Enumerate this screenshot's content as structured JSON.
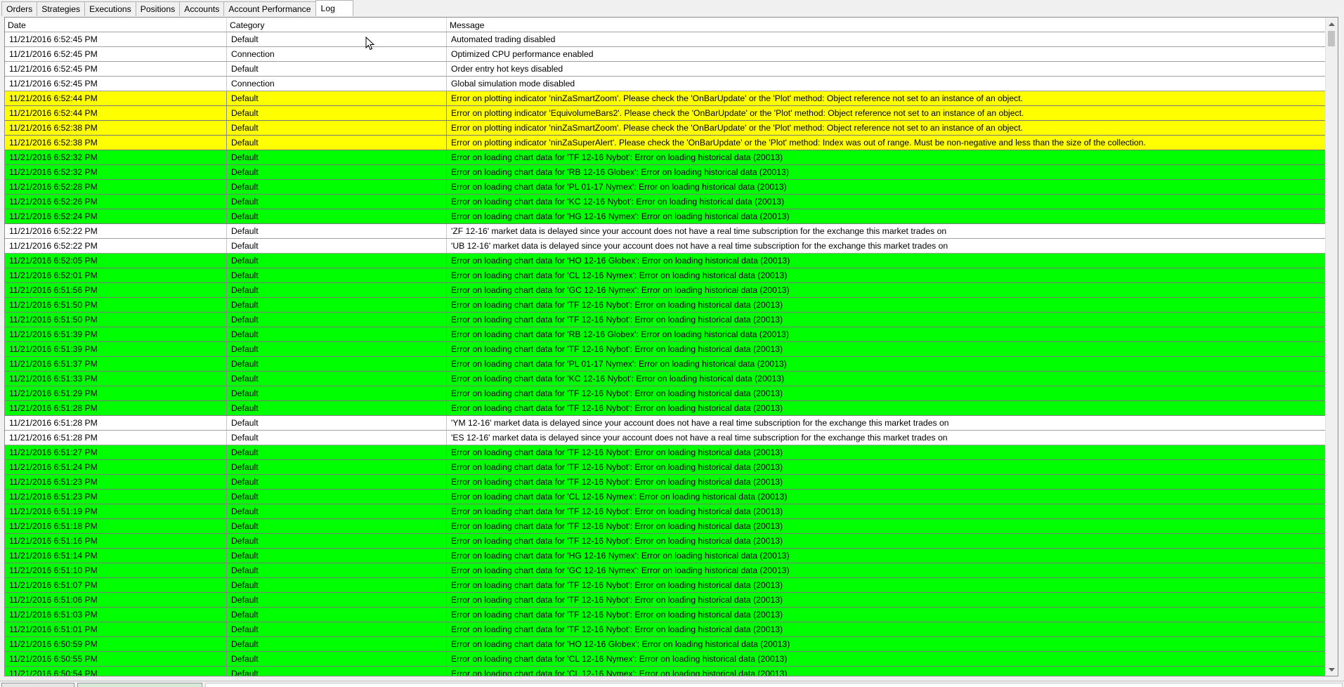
{
  "tabs": [
    {
      "label": "Orders",
      "active": false
    },
    {
      "label": "Strategies",
      "active": false
    },
    {
      "label": "Executions",
      "active": false
    },
    {
      "label": "Positions",
      "active": false
    },
    {
      "label": "Accounts",
      "active": false
    },
    {
      "label": "Account Performance",
      "active": false
    },
    {
      "label": "Log",
      "active": true
    }
  ],
  "grid": {
    "columns": {
      "date": "Date",
      "category": "Category",
      "message": "Message"
    },
    "row_colors": {
      "white": "#ffffff",
      "yellow": "#ffff00",
      "green": "#00ff00"
    },
    "rows": [
      {
        "date": "11/21/2016 6:52:45 PM",
        "category": "Default",
        "message": "Automated trading disabled",
        "color": "white"
      },
      {
        "date": "11/21/2016 6:52:45 PM",
        "category": "Connection",
        "message": "Optimized CPU performance enabled",
        "color": "white"
      },
      {
        "date": "11/21/2016 6:52:45 PM",
        "category": "Default",
        "message": "Order entry hot keys disabled",
        "color": "white"
      },
      {
        "date": "11/21/2016 6:52:45 PM",
        "category": "Connection",
        "message": "Global simulation mode disabled",
        "color": "white"
      },
      {
        "date": "11/21/2016 6:52:44 PM",
        "category": "Default",
        "message": "Error on plotting indicator 'ninZaSmartZoom'. Please check the 'OnBarUpdate' or the 'Plot' method: Object reference not set to an instance of an object.",
        "color": "yellow"
      },
      {
        "date": "11/21/2016 6:52:44 PM",
        "category": "Default",
        "message": "Error on plotting indicator 'EquivolumeBars2'. Please check the 'OnBarUpdate' or the 'Plot' method: Object reference not set to an instance of an object.",
        "color": "yellow"
      },
      {
        "date": "11/21/2016 6:52:38 PM",
        "category": "Default",
        "message": "Error on plotting indicator 'ninZaSmartZoom'. Please check the 'OnBarUpdate' or the 'Plot' method: Object reference not set to an instance of an object.",
        "color": "yellow"
      },
      {
        "date": "11/21/2016 6:52:38 PM",
        "category": "Default",
        "message": "Error on plotting indicator 'ninZaSuperAlert'. Please check the 'OnBarUpdate' or the 'Plot' method: Index was out of range. Must be non-negative and less than the size of the collection.",
        "color": "yellow"
      },
      {
        "date": "11/21/2016 6:52:32 PM",
        "category": "Default",
        "message": "Error on loading chart data for 'TF 12-16 Nybot': Error on loading historical data (20013)",
        "color": "green"
      },
      {
        "date": "11/21/2016 6:52:32 PM",
        "category": "Default",
        "message": "Error on loading chart data for 'RB 12-16 Globex': Error on loading historical data (20013)",
        "color": "green"
      },
      {
        "date": "11/21/2016 6:52:28 PM",
        "category": "Default",
        "message": "Error on loading chart data for 'PL 01-17 Nymex': Error on loading historical data (20013)",
        "color": "green"
      },
      {
        "date": "11/21/2016 6:52:26 PM",
        "category": "Default",
        "message": "Error on loading chart data for 'KC 12-16 Nybot': Error on loading historical data (20013)",
        "color": "green"
      },
      {
        "date": "11/21/2016 6:52:24 PM",
        "category": "Default",
        "message": "Error on loading chart data for 'HG 12-16 Nymex': Error on loading historical data (20013)",
        "color": "green"
      },
      {
        "date": "11/21/2016 6:52:22 PM",
        "category": "Default",
        "message": "'ZF 12-16' market data is delayed since your account does not have a real time subscription for the exchange this market trades on",
        "color": "white"
      },
      {
        "date": "11/21/2016 6:52:22 PM",
        "category": "Default",
        "message": "'UB 12-16' market data is delayed since your account does not have a real time subscription for the exchange this market trades on",
        "color": "white"
      },
      {
        "date": "11/21/2016 6:52:05 PM",
        "category": "Default",
        "message": "Error on loading chart data for 'HO 12-16 Globex': Error on loading historical data (20013)",
        "color": "green"
      },
      {
        "date": "11/21/2016 6:52:01 PM",
        "category": "Default",
        "message": "Error on loading chart data for 'CL 12-16 Nymex': Error on loading historical data (20013)",
        "color": "green"
      },
      {
        "date": "11/21/2016 6:51:56 PM",
        "category": "Default",
        "message": "Error on loading chart data for 'GC 12-16 Nymex': Error on loading historical data (20013)",
        "color": "green"
      },
      {
        "date": "11/21/2016 6:51:50 PM",
        "category": "Default",
        "message": "Error on loading chart data for 'TF 12-16 Nybot': Error on loading historical data (20013)",
        "color": "green"
      },
      {
        "date": "11/21/2016 6:51:50 PM",
        "category": "Default",
        "message": "Error on loading chart data for 'TF 12-16 Nybot': Error on loading historical data (20013)",
        "color": "green"
      },
      {
        "date": "11/21/2016 6:51:39 PM",
        "category": "Default",
        "message": "Error on loading chart data for 'RB 12-16 Globex': Error on loading historical data (20013)",
        "color": "green"
      },
      {
        "date": "11/21/2016 6:51:39 PM",
        "category": "Default",
        "message": "Error on loading chart data for 'TF 12-16 Nybot': Error on loading historical data (20013)",
        "color": "green"
      },
      {
        "date": "11/21/2016 6:51:37 PM",
        "category": "Default",
        "message": "Error on loading chart data for 'PL 01-17 Nymex': Error on loading historical data (20013)",
        "color": "green"
      },
      {
        "date": "11/21/2016 6:51:33 PM",
        "category": "Default",
        "message": "Error on loading chart data for 'KC 12-16 Nybot': Error on loading historical data (20013)",
        "color": "green"
      },
      {
        "date": "11/21/2016 6:51:29 PM",
        "category": "Default",
        "message": "Error on loading chart data for 'TF 12-16 Nybot': Error on loading historical data (20013)",
        "color": "green"
      },
      {
        "date": "11/21/2016 6:51:28 PM",
        "category": "Default",
        "message": "Error on loading chart data for 'TF 12-16 Nybot': Error on loading historical data (20013)",
        "color": "green"
      },
      {
        "date": "11/21/2016 6:51:28 PM",
        "category": "Default",
        "message": "'YM 12-16' market data is delayed since your account does not have a real time subscription for the exchange this market trades on",
        "color": "white"
      },
      {
        "date": "11/21/2016 6:51:28 PM",
        "category": "Default",
        "message": "'ES 12-16' market data is delayed since your account does not have a real time subscription for the exchange this market trades on",
        "color": "white"
      },
      {
        "date": "11/21/2016 6:51:27 PM",
        "category": "Default",
        "message": "Error on loading chart data for 'TF 12-16 Nybot': Error on loading historical data (20013)",
        "color": "green"
      },
      {
        "date": "11/21/2016 6:51:24 PM",
        "category": "Default",
        "message": "Error on loading chart data for 'TF 12-16 Nybot': Error on loading historical data (20013)",
        "color": "green"
      },
      {
        "date": "11/21/2016 6:51:23 PM",
        "category": "Default",
        "message": "Error on loading chart data for 'TF 12-16 Nybot': Error on loading historical data (20013)",
        "color": "green"
      },
      {
        "date": "11/21/2016 6:51:23 PM",
        "category": "Default",
        "message": "Error on loading chart data for 'CL 12-16 Nymex': Error on loading historical data (20013)",
        "color": "green"
      },
      {
        "date": "11/21/2016 6:51:19 PM",
        "category": "Default",
        "message": "Error on loading chart data for 'TF 12-16 Nybot': Error on loading historical data (20013)",
        "color": "green"
      },
      {
        "date": "11/21/2016 6:51:18 PM",
        "category": "Default",
        "message": "Error on loading chart data for 'TF 12-16 Nybot': Error on loading historical data (20013)",
        "color": "green"
      },
      {
        "date": "11/21/2016 6:51:16 PM",
        "category": "Default",
        "message": "Error on loading chart data for 'TF 12-16 Nybot': Error on loading historical data (20013)",
        "color": "green"
      },
      {
        "date": "11/21/2016 6:51:14 PM",
        "category": "Default",
        "message": "Error on loading chart data for 'HG 12-16 Nymex': Error on loading historical data (20013)",
        "color": "green"
      },
      {
        "date": "11/21/2016 6:51:10 PM",
        "category": "Default",
        "message": "Error on loading chart data for 'GC 12-16 Nymex': Error on loading historical data (20013)",
        "color": "green"
      },
      {
        "date": "11/21/2016 6:51:07 PM",
        "category": "Default",
        "message": "Error on loading chart data for 'TF 12-16 Nybot': Error on loading historical data (20013)",
        "color": "green"
      },
      {
        "date": "11/21/2016 6:51:06 PM",
        "category": "Default",
        "message": "Error on loading chart data for 'TF 12-16 Nybot': Error on loading historical data (20013)",
        "color": "green"
      },
      {
        "date": "11/21/2016 6:51:03 PM",
        "category": "Default",
        "message": "Error on loading chart data for 'TF 12-16 Nybot': Error on loading historical data (20013)",
        "color": "green"
      },
      {
        "date": "11/21/2016 6:51:01 PM",
        "category": "Default",
        "message": "Error on loading chart data for 'TF 12-16 Nybot': Error on loading historical data (20013)",
        "color": "green"
      },
      {
        "date": "11/21/2016 6:50:59 PM",
        "category": "Default",
        "message": "Error on loading chart data for 'HO 12-16 Globex': Error on loading historical data (20013)",
        "color": "green"
      },
      {
        "date": "11/21/2016 6:50:55 PM",
        "category": "Default",
        "message": "Error on loading chart data for 'CL 12-16 Nymex': Error on loading historical data (20013)",
        "color": "green"
      },
      {
        "date": "11/21/2016 6:50:54 PM",
        "category": "Default",
        "message": "Error on loading chart data for 'CL 12-16 Nymex': Error on loading historical data (20013)",
        "color": "green"
      }
    ]
  },
  "scrollbar": {
    "up_icon": "triangle-up",
    "down_icon": "triangle-down"
  },
  "cursor": {
    "icon": "arrow-pointer-icon"
  }
}
